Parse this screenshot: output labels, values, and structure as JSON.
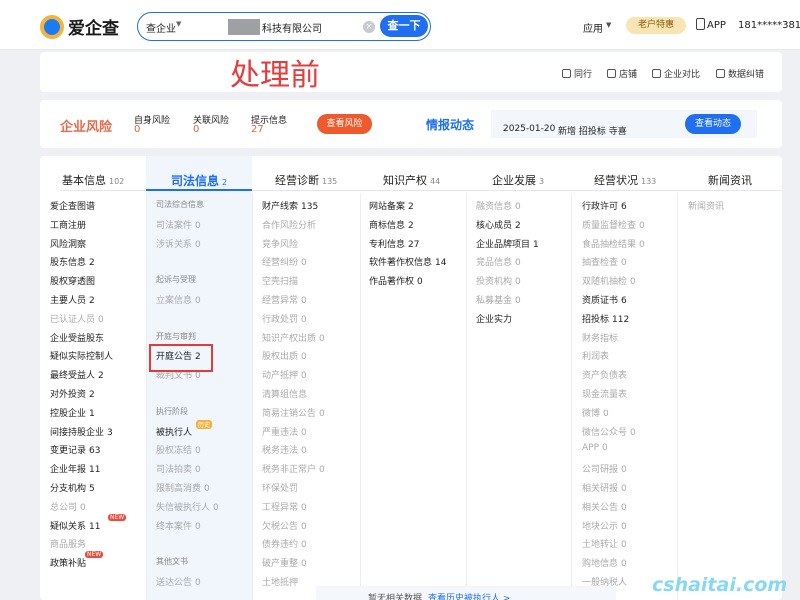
{
  "header": {
    "logo_text": "爱企查",
    "search_scope": "查企业",
    "search_value": "科技有限公司",
    "search_button": "查一下",
    "nav_app": "应用",
    "vip_badge": "老户特惠",
    "app_link": "APP",
    "user": "181*****381"
  },
  "watermarks": {
    "top": "处理前",
    "bottom": "cshaitai.com"
  },
  "toolbar": {
    "items": [
      "同行",
      "店铺",
      "企业对比",
      "数据纠错"
    ]
  },
  "risk": {
    "title": "企业风险",
    "items": [
      {
        "label": "自身风险",
        "value": "0"
      },
      {
        "label": "关联风险",
        "value": "0"
      },
      {
        "label": "提示信息",
        "value": "27"
      }
    ],
    "button": "查看风险",
    "intel_title": "情报动态",
    "intel_date": "2025-01-20",
    "intel_text": "新增 招投标 寺喜",
    "intel_button": "查看动态"
  },
  "tabs": [
    {
      "label": "基本信息",
      "count": "102"
    },
    {
      "label": "司法信息",
      "count": "2"
    },
    {
      "label": "经营诊断",
      "count": "135"
    },
    {
      "label": "知识产权",
      "count": "44"
    },
    {
      "label": "企业发展",
      "count": "3"
    },
    {
      "label": "经营状况",
      "count": "133"
    },
    {
      "label": "新闻资讯",
      "count": ""
    }
  ],
  "col_basic": [
    {
      "label": "爱企查图谱",
      "count": ""
    },
    {
      "label": "工商注册",
      "count": ""
    },
    {
      "label": "风险洞察",
      "count": ""
    },
    {
      "label": "股东信息",
      "count": "2"
    },
    {
      "label": "股权穿透图",
      "count": ""
    },
    {
      "label": "主要人员",
      "count": "2"
    },
    {
      "label": "已认证人员",
      "count": "0"
    },
    {
      "label": "企业受益股东",
      "count": ""
    },
    {
      "label": "疑似实际控制人",
      "count": ""
    },
    {
      "label": "最终受益人",
      "count": "2"
    },
    {
      "label": "对外投资",
      "count": "2"
    },
    {
      "label": "控股企业",
      "count": "1"
    },
    {
      "label": "间接持股企业",
      "count": "3"
    },
    {
      "label": "变更记录",
      "count": "63"
    },
    {
      "label": "企业年报",
      "count": "11"
    },
    {
      "label": "分支机构",
      "count": "5"
    },
    {
      "label": "总公司",
      "count": "0"
    },
    {
      "label": "疑似关系",
      "count": "11"
    },
    {
      "label": "商品服务",
      "count": ""
    },
    {
      "label": "政策补贴",
      "count": ""
    }
  ],
  "col_judicial": [
    {
      "label": "司法综合信息",
      "count": "",
      "type": "head"
    },
    {
      "label": "司法案件",
      "count": "0"
    },
    {
      "label": "涉诉关系",
      "count": "0"
    },
    {
      "label": "",
      "type": "gap"
    },
    {
      "label": "起诉与受理",
      "count": "",
      "type": "head"
    },
    {
      "label": "立案信息",
      "count": "0"
    },
    {
      "label": "",
      "type": "gap"
    },
    {
      "label": "开庭与审判",
      "count": "",
      "type": "head"
    },
    {
      "label": "开庭公告",
      "count": "2"
    },
    {
      "label": "裁判文书",
      "count": "0"
    },
    {
      "label": "",
      "type": "gap"
    },
    {
      "label": "执行阶段",
      "count": "",
      "type": "head"
    },
    {
      "label": "被执行人",
      "count": ""
    },
    {
      "label": "股权冻结",
      "count": "0"
    },
    {
      "label": "司法拍卖",
      "count": "0"
    },
    {
      "label": "限制高消费",
      "count": "0"
    },
    {
      "label": "失信被执行人",
      "count": "0"
    },
    {
      "label": "终本案件",
      "count": "0"
    },
    {
      "label": "",
      "type": "gap"
    },
    {
      "label": "其他文书",
      "count": "",
      "type": "head"
    },
    {
      "label": "送达公告",
      "count": "0"
    }
  ],
  "col_diag": [
    {
      "label": "财产线索",
      "count": "135"
    },
    {
      "label": "合作风险分析",
      "count": ""
    },
    {
      "label": "竞争风险",
      "count": ""
    },
    {
      "label": "经营纠纷",
      "count": "0"
    },
    {
      "label": "空壳扫描",
      "count": ""
    },
    {
      "label": "经营异常",
      "count": "0"
    },
    {
      "label": "行政处罚",
      "count": "0"
    },
    {
      "label": "知识产权出质",
      "count": "0"
    },
    {
      "label": "股权出质",
      "count": "0"
    },
    {
      "label": "动产抵押",
      "count": "0"
    },
    {
      "label": "清算组信息",
      "count": ""
    },
    {
      "label": "简易注销公告",
      "count": "0"
    },
    {
      "label": "严重违法",
      "count": "0"
    },
    {
      "label": "税务违法",
      "count": "0"
    },
    {
      "label": "税务非正常户",
      "count": "0"
    },
    {
      "label": "环保处罚",
      "count": ""
    },
    {
      "label": "工程异常",
      "count": "0"
    },
    {
      "label": "欠税公告",
      "count": "0"
    },
    {
      "label": "债券违约",
      "count": "0"
    },
    {
      "label": "破产重整",
      "count": "0"
    },
    {
      "label": "土地抵押",
      "count": ""
    }
  ],
  "col_ip": [
    {
      "label": "网站备案",
      "count": "2"
    },
    {
      "label": "商标信息",
      "count": "2"
    },
    {
      "label": "专利信息",
      "count": "27"
    },
    {
      "label": "软件著作权信息",
      "count": "14"
    },
    {
      "label": "作品著作权",
      "count": "0"
    }
  ],
  "col_dev": [
    {
      "label": "融资信息",
      "count": "0"
    },
    {
      "label": "核心成员",
      "count": "2"
    },
    {
      "label": "企业品牌项目",
      "count": "1"
    },
    {
      "label": "竞品信息",
      "count": "0"
    },
    {
      "label": "投资机构",
      "count": "0"
    },
    {
      "label": "私募基金",
      "count": "0"
    },
    {
      "label": "企业实力",
      "count": ""
    }
  ],
  "col_ops": [
    {
      "label": "行政许可",
      "count": "6"
    },
    {
      "label": "质量监督检查",
      "count": "0"
    },
    {
      "label": "食品抽检结果",
      "count": "0"
    },
    {
      "label": "抽查检查",
      "count": "0"
    },
    {
      "label": "双随机抽检",
      "count": "0"
    },
    {
      "label": "资质证书",
      "count": "6"
    },
    {
      "label": "招投标",
      "count": "112"
    },
    {
      "label": "财务指标",
      "count": ""
    },
    {
      "label": "利润表",
      "count": ""
    },
    {
      "label": "资产负债表",
      "count": ""
    },
    {
      "label": "现金流量表",
      "count": ""
    },
    {
      "label": "微博",
      "count": "0"
    },
    {
      "label": "微信公众号",
      "count": "0"
    },
    {
      "label": "APP",
      "count": "0"
    },
    {
      "label": "公司研报",
      "count": "0"
    },
    {
      "label": "相关研报",
      "count": "0"
    },
    {
      "label": "相关公告",
      "count": "0"
    },
    {
      "label": "地块公示",
      "count": "0"
    },
    {
      "label": "土地转让",
      "count": "0"
    },
    {
      "label": "购地信息",
      "count": "0"
    },
    {
      "label": "一般纳税人",
      "count": ""
    }
  ],
  "col_news": [
    {
      "label": "新闻资讯",
      "count": ""
    }
  ],
  "bottom": {
    "hint": "暂无相关数据",
    "link": "查看历史被执行人 >"
  }
}
